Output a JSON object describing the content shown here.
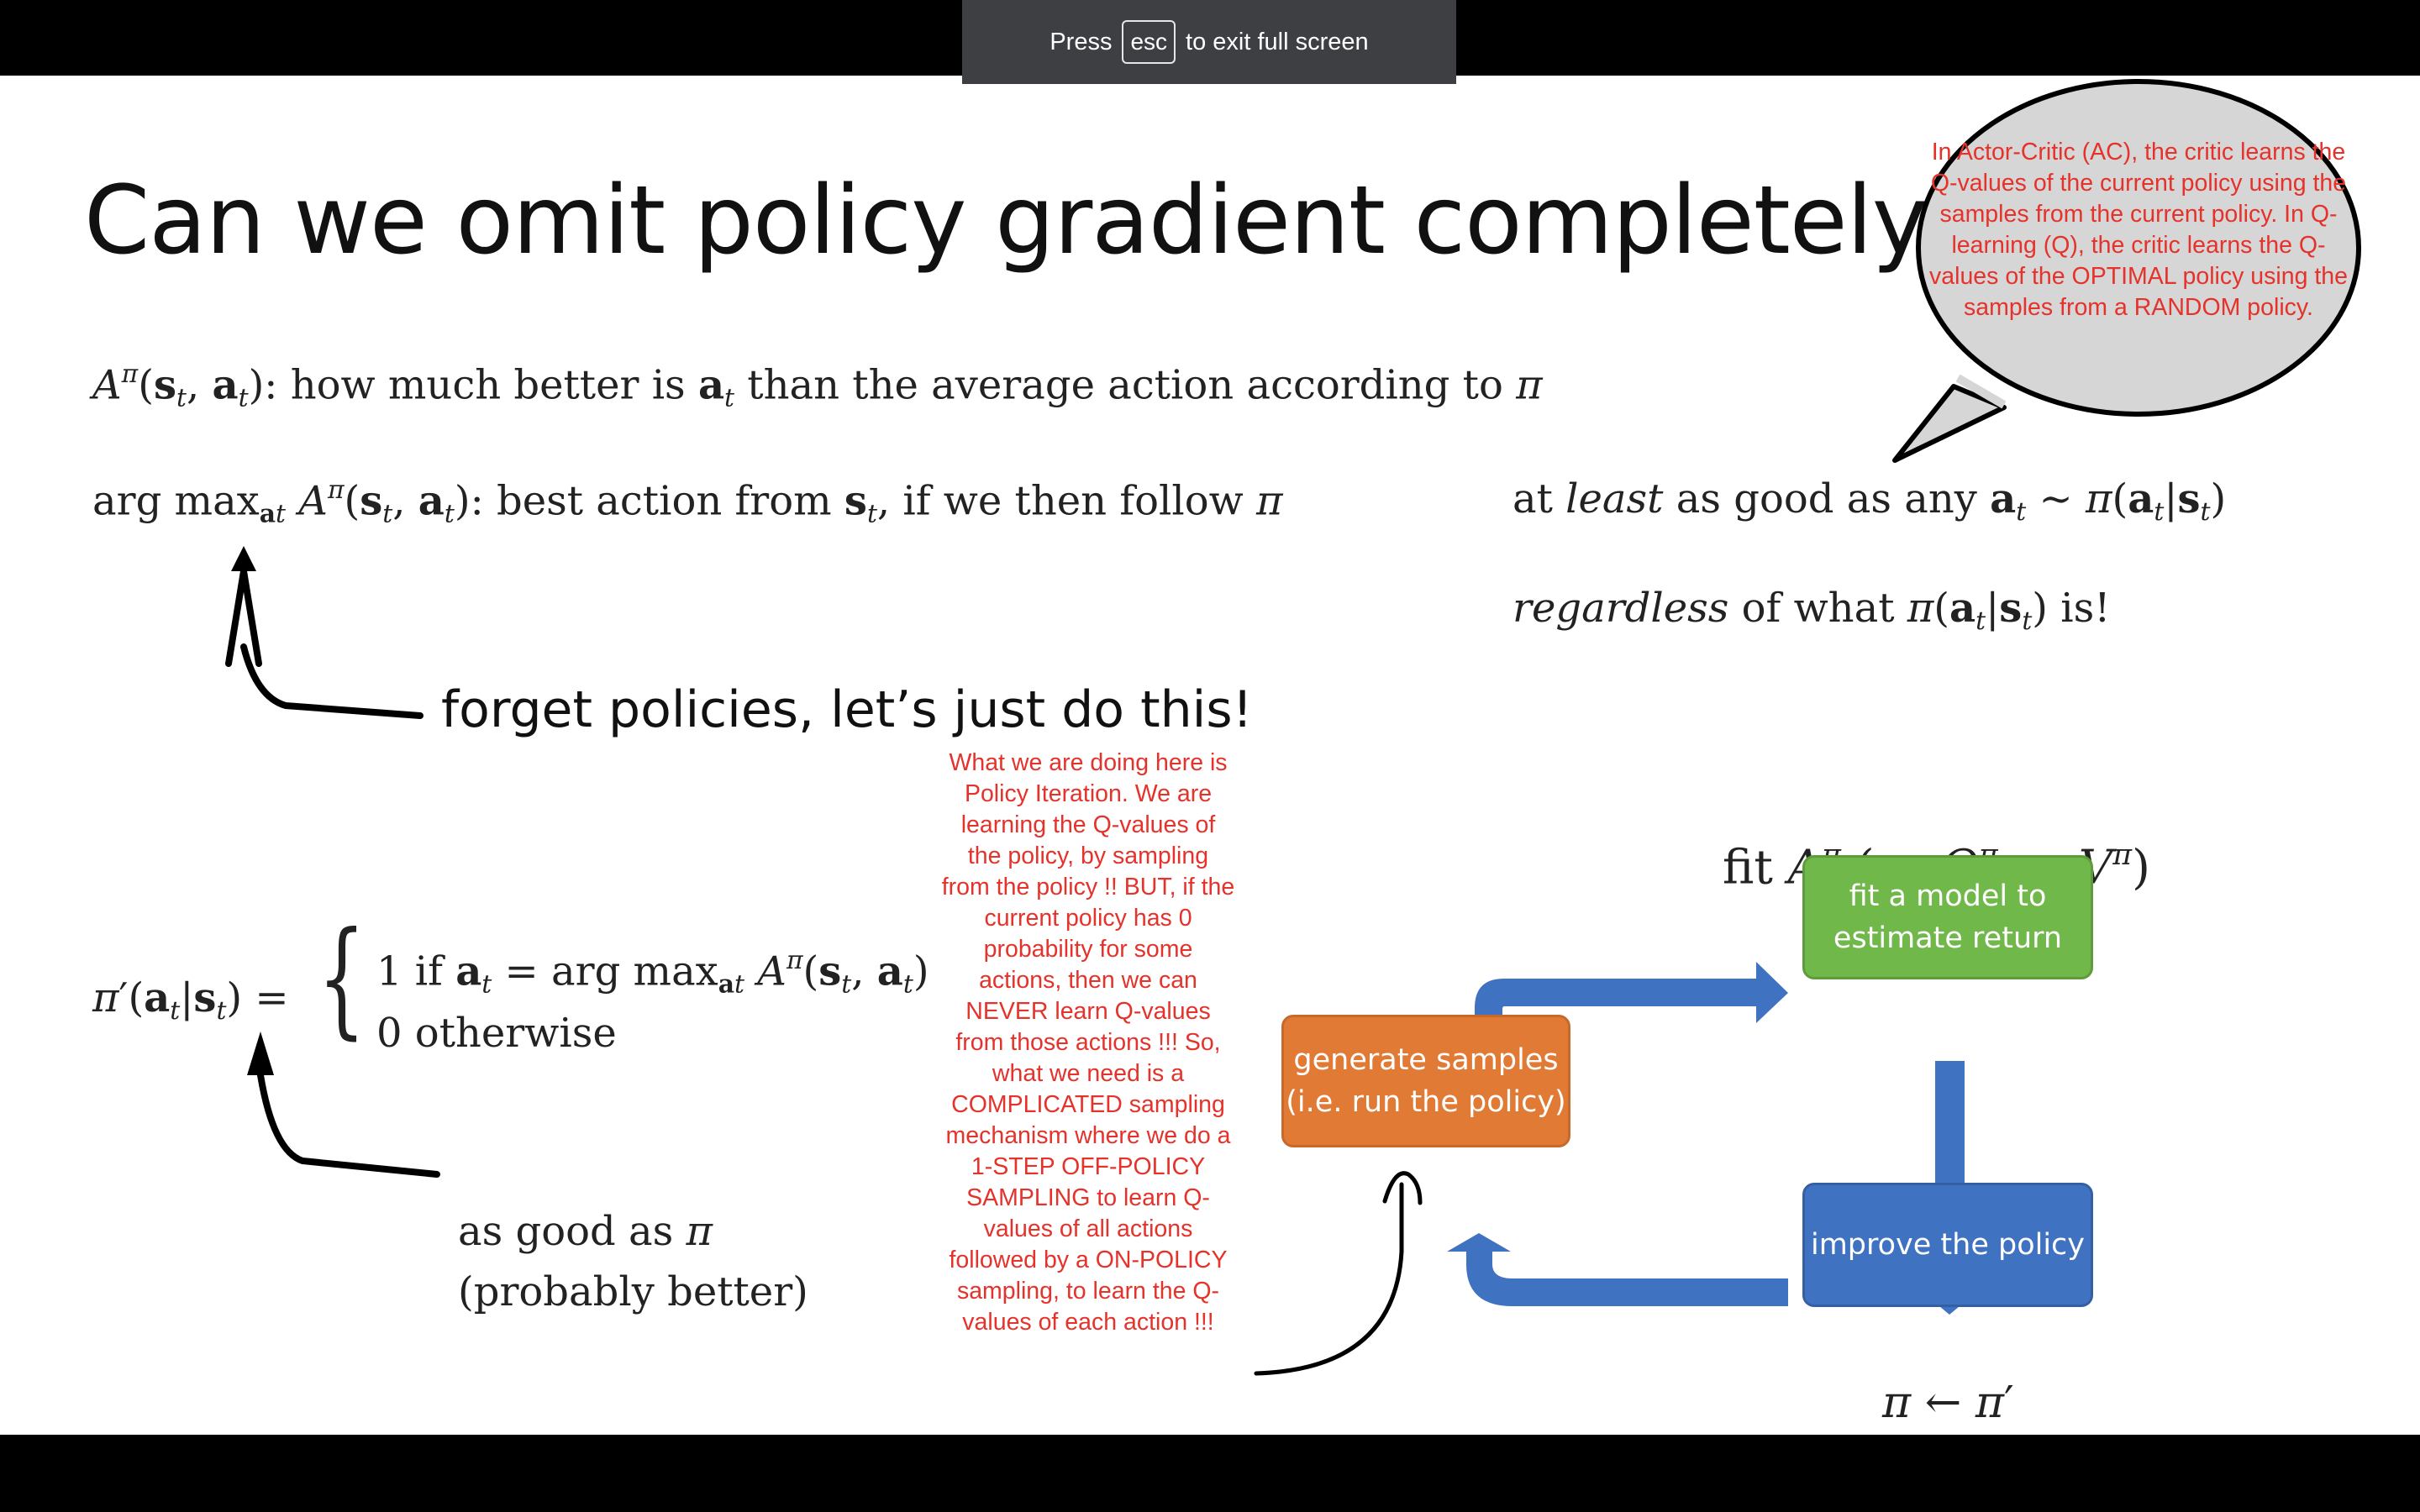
{
  "fullscreen_banner": {
    "press": "Press",
    "key": "esc",
    "suffix": "to exit full screen"
  },
  "slide": {
    "title": "Can we omit policy gradient completely?",
    "advantage_line": ": how much better is",
    "advantage_tail": "than the average action according to",
    "argmax_line": ": best action from",
    "argmax_tail": ", if we then follow",
    "at_least": "at",
    "least": "least",
    "as_good_as_any": "as good as any",
    "regardless": "regardless",
    "of_what": "of what",
    "is_excl": "is!",
    "forget_text": "forget policies, let’s just do this!",
    "case_one": "1 if",
    "case_zero": "0 otherwise",
    "as_good_as": "as good as",
    "probably_better": "(probably better)",
    "fit_label": "fit",
    "or1": "(or",
    "or2": "or",
    "close_paren": ")"
  },
  "annotations": {
    "bubble_text": "In Actor-Critic (AC), the critic learns the Q-values of the current policy using the samples from the current policy. In Q-learning (Q), the critic learns the Q-values of the OPTIMAL policy using the samples from a RANDOM policy.",
    "center_note": "What we are doing here is Policy Iteration. We are learning the Q-values of the policy, by sampling from the policy !! BUT, if the current policy has 0 probability for some actions, then we can NEVER learn Q-values from those actions !!! So, what we need is a COMPLICATED sampling mechanism where we do a 1-STEP OFF-POLICY SAMPLING to learn Q-values of all actions followed by a ON-POLICY sampling, to learn the Q-values of each action !!!"
  },
  "diagram": {
    "fit_box": "fit a model to estimate return",
    "generate_box": "generate samples (i.e. run the policy)",
    "improve_box": "improve the policy"
  },
  "colors": {
    "annotation_red": "#e5322b",
    "green_box": "#71b84a",
    "orange_box": "#e07a35",
    "blue_box": "#3f72c0",
    "arrow_blue": "#3f72c0"
  }
}
